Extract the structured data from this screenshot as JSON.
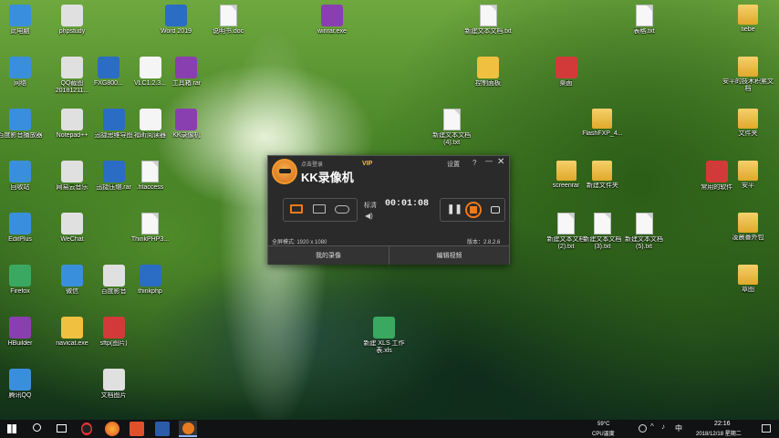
{
  "desktop_icons": [
    {
      "label": "此电脑",
      "col": 0,
      "row": 0
    },
    {
      "label": "phpstudy",
      "col": 1,
      "row": 0
    },
    {
      "label": "Word 2019",
      "col": 3,
      "row": 0
    },
    {
      "label": "说明书.doc",
      "col": 4,
      "row": 0
    },
    {
      "label": "winrar.exe",
      "col": 6,
      "row": 0
    },
    {
      "label": "新建文本文档.txt",
      "col": 9,
      "row": 0
    },
    {
      "label": "表格.txt",
      "col": 12,
      "row": 0
    },
    {
      "label": "tiebe",
      "col": 14,
      "row": 0
    },
    {
      "label": "网络",
      "col": 0,
      "row": 1
    },
    {
      "label": "QQ截图20181211...",
      "col": 1,
      "row": 1
    },
    {
      "label": "FXG800...",
      "col": 1.7,
      "row": 1
    },
    {
      "label": "VLC1.2.3...",
      "col": 2.5,
      "row": 1
    },
    {
      "label": "工具箱.rar",
      "col": 3.2,
      "row": 1
    },
    {
      "label": "控制面板",
      "col": 9,
      "row": 1
    },
    {
      "label": "桌面",
      "col": 10.5,
      "row": 1
    },
    {
      "label": "安平的技术积累文档",
      "col": 14,
      "row": 1
    },
    {
      "label": "百度影音播放器",
      "col": 0,
      "row": 2
    },
    {
      "label": "Notepad++",
      "col": 1,
      "row": 2
    },
    {
      "label": "迅捷思维导图",
      "col": 1.8,
      "row": 2
    },
    {
      "label": "福昕阅读器",
      "col": 2.5,
      "row": 2
    },
    {
      "label": "KK录像机",
      "col": 3.2,
      "row": 2
    },
    {
      "label": "新建文本文档(4).txt",
      "col": 8.3,
      "row": 2
    },
    {
      "label": "FlashFXP_4...",
      "col": 11.2,
      "row": 2
    },
    {
      "label": "文件夹",
      "col": 14,
      "row": 2
    },
    {
      "label": "回收站",
      "col": 0,
      "row": 3
    },
    {
      "label": "网易云音乐",
      "col": 1,
      "row": 3
    },
    {
      "label": "迅捷压缩.rar",
      "col": 1.8,
      "row": 3
    },
    {
      "label": ".htaccess",
      "col": 2.5,
      "row": 3
    },
    {
      "label": "screenrar",
      "col": 10.5,
      "row": 3
    },
    {
      "label": "新建文件夹",
      "col": 11.2,
      "row": 3
    },
    {
      "label": "常用的软件",
      "col": 13.4,
      "row": 3
    },
    {
      "label": "安平",
      "col": 14,
      "row": 3
    },
    {
      "label": "EditPlus",
      "col": 0,
      "row": 4
    },
    {
      "label": "WeChat",
      "col": 1,
      "row": 4
    },
    {
      "label": "ThinkPHP3...",
      "col": 2.5,
      "row": 4
    },
    {
      "label": "新建文本文档(2).txt",
      "col": 10.5,
      "row": 4
    },
    {
      "label": "新建文本文档(3).txt",
      "col": 11.2,
      "row": 4
    },
    {
      "label": "新建文本文档(5).txt",
      "col": 12,
      "row": 4
    },
    {
      "label": "凌晨番外包",
      "col": 14,
      "row": 4
    },
    {
      "label": "Firefox",
      "col": 0,
      "row": 5
    },
    {
      "label": "微信",
      "col": 1,
      "row": 5
    },
    {
      "label": "百度影音",
      "col": 1.8,
      "row": 5
    },
    {
      "label": "thinkphp",
      "col": 2.5,
      "row": 5
    },
    {
      "label": "章图",
      "col": 14,
      "row": 5
    },
    {
      "label": "HBuilder",
      "col": 0,
      "row": 6
    },
    {
      "label": "navicat.exe",
      "col": 1,
      "row": 6
    },
    {
      "label": "sftp(图片)",
      "col": 1.8,
      "row": 6
    },
    {
      "label": "新建 XLS 工作表.xls",
      "col": 7,
      "row": 6
    },
    {
      "label": "腾讯QQ",
      "col": 0,
      "row": 7
    },
    {
      "label": "文档图片",
      "col": 1.8,
      "row": 7
    }
  ],
  "recorder": {
    "title": "KK录像机",
    "click_login": "点击登录",
    "vip": "VIP",
    "settings": "设置",
    "help": "?",
    "quality": "标清",
    "timer": "00:01:08",
    "mode_info": "全屏模式: 1920 x 1080",
    "version": "版本：2.8.2.6",
    "my_recordings": "我的录像",
    "edit_video": "编辑视频"
  },
  "taskbar": {
    "temperature": "59°C",
    "temp_label": "CPU温度",
    "ime": "中",
    "time": "22:16",
    "date": "2018/12/18 星期二"
  },
  "colors": {
    "accent": "#f07a1a",
    "taskbar": "#101214",
    "window": "#2a2a2a"
  }
}
